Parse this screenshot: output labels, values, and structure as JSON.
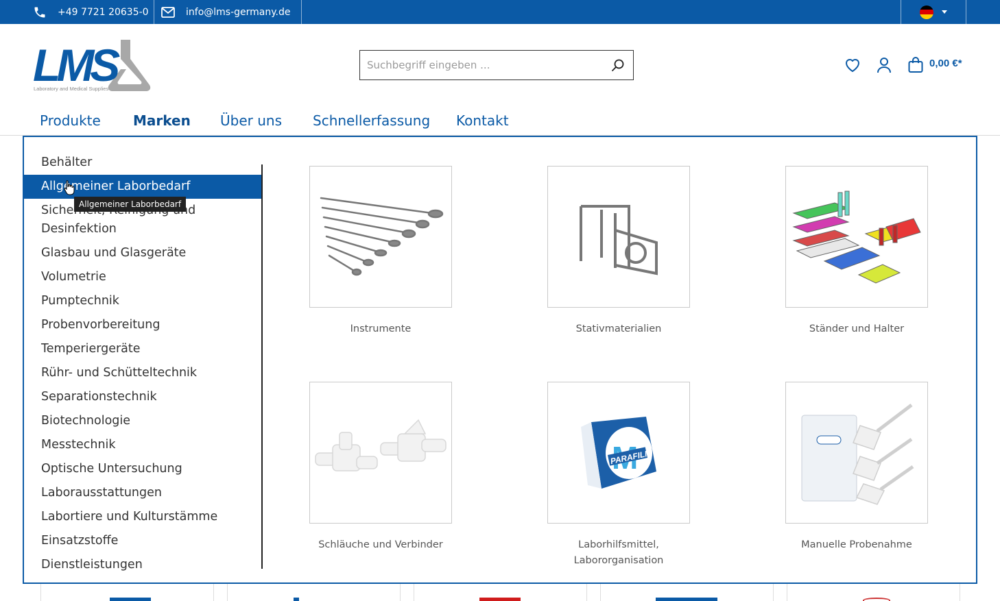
{
  "topbar": {
    "phone": "+49 7721 20635-0",
    "email": "info@lms-germany.de",
    "language_icon": "flag-de-icon",
    "flag_colors": [
      "#000000",
      "#dd0000",
      "#ffce00"
    ]
  },
  "header": {
    "logo_text": "LMS",
    "logo_tagline": "Laboratory and Medical Supplies",
    "search_placeholder": "Suchbegriff eingeben ...",
    "cart_total": "0,00 €*"
  },
  "nav": {
    "items": [
      {
        "label": "Produkte",
        "active": false
      },
      {
        "label": "Marken",
        "active": true
      },
      {
        "label": "Über uns",
        "active": false
      },
      {
        "label": "Schnellerfassung",
        "active": false
      },
      {
        "label": "Kontakt",
        "active": false
      }
    ]
  },
  "categories": [
    {
      "label": "Behälter"
    },
    {
      "label": "Allgemeiner Laborbedarf",
      "active": true
    },
    {
      "label": "Sicherheit, Reinigung und\nDesinfektion"
    },
    {
      "label": "Glasbau und Glasgeräte"
    },
    {
      "label": "Volumetrie"
    },
    {
      "label": "Pumptechnik"
    },
    {
      "label": "Probenvorbereitung"
    },
    {
      "label": "Temperiergeräte"
    },
    {
      "label": "Rühr- und Schütteltechnik"
    },
    {
      "label": "Separationstechnik"
    },
    {
      "label": "Biotechnologie"
    },
    {
      "label": "Messtechnik"
    },
    {
      "label": "Optische Untersuchung"
    },
    {
      "label": "Laborausstattungen"
    },
    {
      "label": "Labortiere und Kulturstämme"
    },
    {
      "label": "Einsatzstoffe"
    },
    {
      "label": "Dienstleistungen"
    }
  ],
  "tooltip": "Allgemeiner Laborbedarf",
  "subcategories": [
    {
      "label": "Instrumente"
    },
    {
      "label": "Stativmaterialien"
    },
    {
      "label": "Ständer und Halter"
    },
    {
      "label": "Schläuche und Verbinder"
    },
    {
      "label": "Laborhilfsmittel,\nLabororganisation"
    },
    {
      "label": "Manuelle Probenahme"
    }
  ],
  "colors": {
    "brand_blue": "#0b5aa6",
    "logo_gray": "#a8a8a8"
  }
}
